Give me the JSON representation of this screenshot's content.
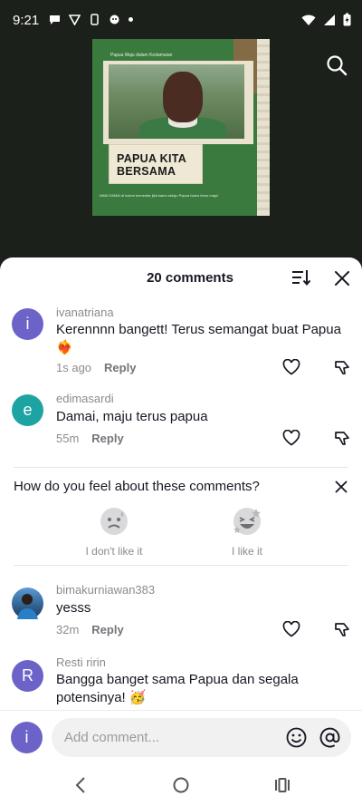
{
  "status_bar": {
    "time": "9:21"
  },
  "thumbnail": {
    "top_caption": "Papua Maju dalam Kedamaian",
    "title": "PAPUA KITA BERSAMA",
    "bottom_caption": "NANI ZAMAI di kolom komentar jika kamu setuju Papua harus terus maju!"
  },
  "sheet": {
    "title": "20 comments"
  },
  "comments": [
    {
      "initial": "i",
      "avatar_color": "#6c63c9",
      "username": "ivanatriana",
      "text": "Kerennnn bangett! Terus semangat buat Papua ❤️‍🔥",
      "time": "1s ago",
      "reply": "Reply"
    },
    {
      "initial": "e",
      "avatar_color": "#1ea3a3",
      "username": "edimasardi",
      "text": "Damai, maju terus papua",
      "time": "55m",
      "reply": "Reply"
    },
    {
      "initial": "",
      "avatar_color": "#3a6ea5",
      "username": "bimakurniawan383",
      "text": "yesss",
      "time": "32m",
      "reply": "Reply"
    },
    {
      "initial": "R",
      "avatar_color": "#6c63c9",
      "username": "Resti ririn",
      "text": "Bangga banget sama Papua dan segala potensinya! 🥳"
    }
  ],
  "feedback": {
    "question": "How do you feel about these comments?",
    "dislike_label": "I don't like it",
    "like_label": "I like it"
  },
  "input": {
    "placeholder": "Add comment...",
    "avatar_initial": "i"
  },
  "colors": {
    "accent_avatar": "#6c63c9",
    "teal_avatar": "#1ea3a3"
  }
}
